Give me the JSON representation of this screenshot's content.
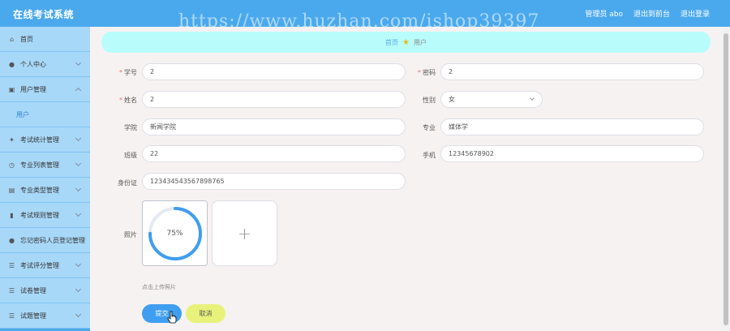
{
  "app": {
    "title": "在线考试系统"
  },
  "header": {
    "admin_label": "管理员 abo",
    "back_label": "退出到前台",
    "logout_label": "退出登录"
  },
  "watermark": "https://www.huzhan.com/ishop39397",
  "sidebar": {
    "items": [
      {
        "label": "首页",
        "icon": "home-icon",
        "glyph": "⌂"
      },
      {
        "label": "个人中心",
        "icon": "user-icon",
        "glyph": "●"
      },
      {
        "label": "用户管理",
        "icon": "users-icon",
        "glyph": "▣"
      },
      {
        "label": "考试统计管理",
        "icon": "stats-icon",
        "glyph": "✦"
      },
      {
        "label": "专业列表管理",
        "icon": "clock-icon",
        "glyph": "◷"
      },
      {
        "label": "专业类型管理",
        "icon": "clipboard-icon",
        "glyph": "▤"
      },
      {
        "label": "考试规则管理",
        "icon": "chart-icon",
        "glyph": "▮"
      },
      {
        "label": "忘记密码人员登记管理",
        "icon": "person-icon",
        "glyph": "●"
      },
      {
        "label": "考试评分管理",
        "icon": "list-icon",
        "glyph": "☰"
      },
      {
        "label": "试卷管理",
        "icon": "menu-icon",
        "glyph": "☰"
      },
      {
        "label": "试题管理",
        "icon": "menu-icon",
        "glyph": "☰"
      }
    ],
    "sub_user": "用户"
  },
  "breadcrumb": {
    "home": "首页",
    "current": "用户"
  },
  "form": {
    "student_no": {
      "label": "学号",
      "value": "2"
    },
    "password": {
      "label": "密码",
      "value": "2"
    },
    "name": {
      "label": "姓名",
      "value": "2"
    },
    "gender": {
      "label": "性别",
      "value": "女"
    },
    "college": {
      "label": "学院",
      "value": "新闻学院"
    },
    "major": {
      "label": "专业",
      "value": "媒体学"
    },
    "class": {
      "label": "班级",
      "value": "22"
    },
    "phone": {
      "label": "手机",
      "value": "12345678902"
    },
    "id_card": {
      "label": "身份证",
      "value": "123434543567898765"
    },
    "photo": {
      "label": "照片",
      "progress_text": "75%",
      "progress": 0.75,
      "add_glyph": "+",
      "tip": "点击上传照片"
    }
  },
  "buttons": {
    "submit": "提交",
    "cancel": "取消"
  },
  "colors": {
    "primary": "#4aa9ed",
    "sidebar_bg": "#a8d8f8",
    "breadcrumb_bg": "#b8fdfb",
    "submit": "#3f9ef0",
    "cancel": "#e8f27a",
    "required": "#f56c6c"
  }
}
